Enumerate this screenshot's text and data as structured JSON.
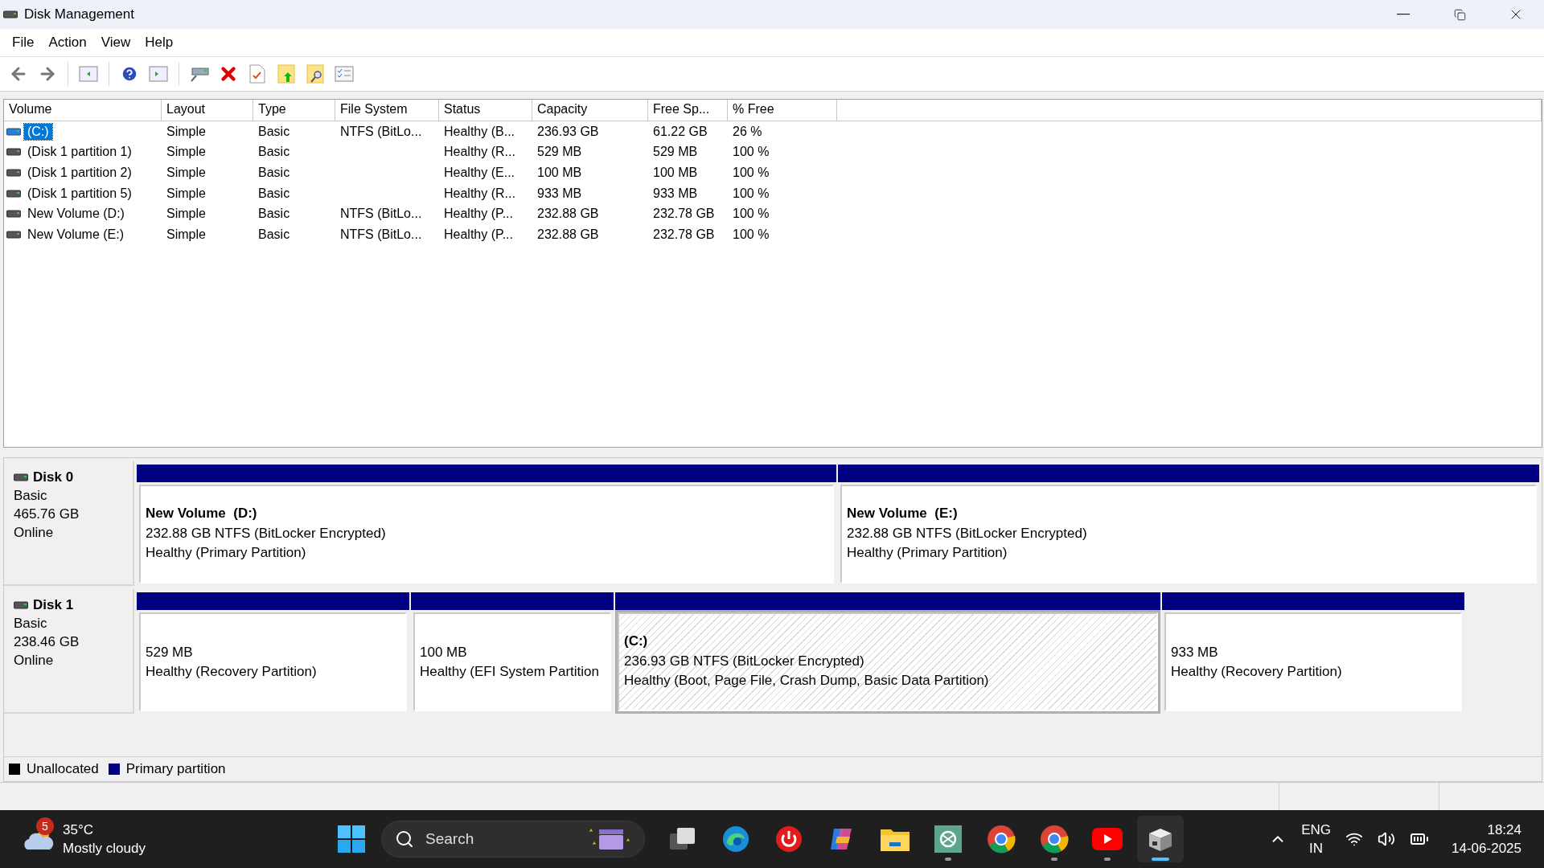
{
  "window": {
    "title": "Disk Management"
  },
  "menu": [
    "File",
    "Action",
    "View",
    "Help"
  ],
  "volume_table": {
    "columns": [
      "Volume",
      "Layout",
      "Type",
      "File System",
      "Status",
      "Capacity",
      "Free Sp...",
      "% Free"
    ],
    "rows": [
      {
        "selected": true,
        "cells": [
          "(C:)",
          "Simple",
          "Basic",
          "NTFS (BitLo...",
          "Healthy (B...",
          "236.93 GB",
          "61.22 GB",
          "26 %"
        ]
      },
      {
        "selected": false,
        "cells": [
          "(Disk 1 partition 1)",
          "Simple",
          "Basic",
          "",
          "Healthy (R...",
          "529 MB",
          "529 MB",
          "100 %"
        ]
      },
      {
        "selected": false,
        "cells": [
          "(Disk 1 partition 2)",
          "Simple",
          "Basic",
          "",
          "Healthy (E...",
          "100 MB",
          "100 MB",
          "100 %"
        ]
      },
      {
        "selected": false,
        "cells": [
          "(Disk 1 partition 5)",
          "Simple",
          "Basic",
          "",
          "Healthy (R...",
          "933 MB",
          "933 MB",
          "100 %"
        ]
      },
      {
        "selected": false,
        "cells": [
          "New Volume (D:)",
          "Simple",
          "Basic",
          "NTFS (BitLo...",
          "Healthy (P...",
          "232.88 GB",
          "232.78 GB",
          "100 %"
        ]
      },
      {
        "selected": false,
        "cells": [
          "New Volume (E:)",
          "Simple",
          "Basic",
          "NTFS (BitLo...",
          "Healthy (P...",
          "232.88 GB",
          "232.78 GB",
          "100 %"
        ]
      }
    ]
  },
  "disks": [
    {
      "name": "Disk 0",
      "type": "Basic",
      "size": "465.76 GB",
      "status": "Online",
      "partitions": [
        {
          "title": "New Volume  (D:)",
          "detail": "232.88 GB NTFS (BitLocker Encrypted)",
          "health": "Healthy (Primary Partition)",
          "selected": false
        },
        {
          "title": "New Volume  (E:)",
          "detail": "232.88 GB NTFS (BitLocker Encrypted)",
          "health": "Healthy (Primary Partition)",
          "selected": false
        }
      ]
    },
    {
      "name": "Disk 1",
      "type": "Basic",
      "size": "238.46 GB",
      "status": "Online",
      "partitions": [
        {
          "detail": "529 MB",
          "health": "Healthy (Recovery Partition)",
          "selected": false
        },
        {
          "detail": "100 MB",
          "health": "Healthy (EFI System Partition",
          "selected": false
        },
        {
          "title": "(C:)",
          "detail": "236.93 GB NTFS (BitLocker Encrypted)",
          "health": "Healthy (Boot, Page File, Crash Dump, Basic Data Partition)",
          "selected": true
        },
        {
          "detail": "933 MB",
          "health": "Healthy (Recovery Partition)",
          "selected": false
        }
      ]
    }
  ],
  "legend": [
    {
      "label": "Unallocated",
      "color": "#000000"
    },
    {
      "label": "Primary partition",
      "color": "#000080"
    }
  ],
  "taskbar": {
    "weather": {
      "badge": "5",
      "temperature": "35°C",
      "condition": "Mostly cloudy"
    },
    "search": {
      "placeholder": "Search"
    },
    "apps": [
      {
        "kind": "taskview",
        "running": false,
        "selected": false
      },
      {
        "kind": "edge",
        "running": false,
        "selected": false
      },
      {
        "kind": "power",
        "running": false,
        "selected": false
      },
      {
        "kind": "copilot",
        "running": false,
        "selected": false
      },
      {
        "kind": "folder",
        "running": false,
        "selected": false
      },
      {
        "kind": "chatgpt",
        "running": true,
        "selected": false
      },
      {
        "kind": "chrome",
        "running": false,
        "selected": false
      },
      {
        "kind": "chrome",
        "running": true,
        "selected": false
      },
      {
        "kind": "youtube",
        "running": true,
        "selected": false
      },
      {
        "kind": "diskmgmt",
        "running": true,
        "selected": true
      }
    ],
    "language": "ENG",
    "region": "IN",
    "time": "18:24",
    "date": "14-06-2025"
  }
}
